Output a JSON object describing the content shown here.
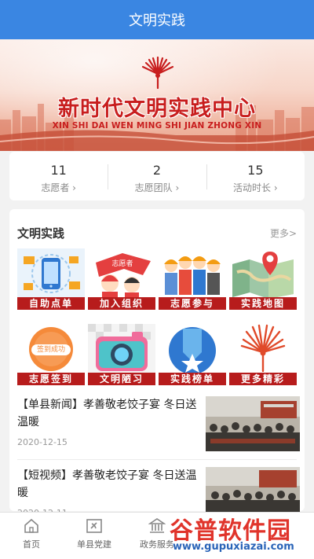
{
  "header": {
    "title": "文明实践"
  },
  "banner": {
    "title": "新时代文明实践中心",
    "pinyin": "XIN SHI DAI WEN MING SHI JIAN ZHONG XIN"
  },
  "stats": [
    {
      "value": "11",
      "label": "志愿者 ›"
    },
    {
      "value": "2",
      "label": "志愿团队 ›"
    },
    {
      "value": "15",
      "label": "活动时长 ›"
    }
  ],
  "section": {
    "title": "文明实践",
    "more": "更多>",
    "tiles": [
      {
        "label": "自助点单",
        "icon": "phone-icon"
      },
      {
        "label": "加入组织",
        "icon": "volunteer-flag-icon"
      },
      {
        "label": "志愿参与",
        "icon": "workers-icon"
      },
      {
        "label": "实践地图",
        "icon": "map-pin-icon"
      },
      {
        "label": "志愿签到",
        "icon": "signin-icon",
        "badge": "签到成功"
      },
      {
        "label": "文明陋习",
        "icon": "camera-icon"
      },
      {
        "label": "实践榜单",
        "icon": "medal-icon"
      },
      {
        "label": "更多精彩",
        "icon": "fan-logo-icon"
      }
    ]
  },
  "news": [
    {
      "title": "【单县新闻】孝善敬老饺子宴 冬日送温暖",
      "date": "2020-12-15"
    },
    {
      "title": "【短视频】孝善敬老饺子宴 冬日送温暖",
      "date": "2020-12-11"
    }
  ],
  "tabbar": [
    {
      "label": "首页"
    },
    {
      "label": "单县党建"
    },
    {
      "label": "政务服务"
    }
  ],
  "watermark": {
    "brand": "谷普软件园",
    "url": "www.gupuxiazai.com"
  },
  "colors": {
    "primary": "#3a86e2",
    "caption": "#b71c1c",
    "banner_title": "#c81e1e"
  }
}
